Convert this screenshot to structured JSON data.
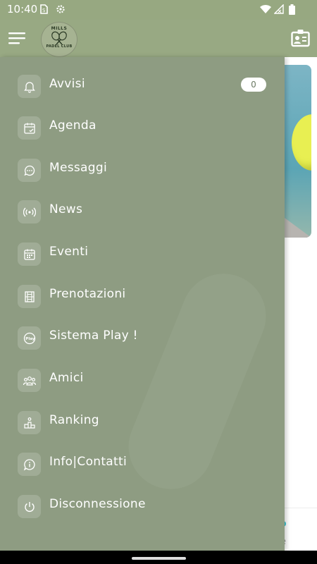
{
  "status_bar": {
    "time": "10:40"
  },
  "app_bar": {
    "logo_line1": "MILLS",
    "logo_line2": "PADEL CLUB"
  },
  "menu": {
    "items": [
      {
        "label": "Avvisi",
        "icon": "bell-icon",
        "badge": "0"
      },
      {
        "label": "Agenda",
        "icon": "calendar-check-icon"
      },
      {
        "label": "Messaggi",
        "icon": "chat-icon"
      },
      {
        "label": "News",
        "icon": "broadcast-icon"
      },
      {
        "label": "Eventi",
        "icon": "calendar-grid-icon"
      },
      {
        "label": "Prenotazioni",
        "icon": "court-icon"
      },
      {
        "label": "Sistema Play !",
        "icon": "play-icon"
      },
      {
        "label": "Amici",
        "icon": "friends-icon"
      },
      {
        "label": "Ranking",
        "icon": "podium-icon"
      },
      {
        "label": "Info|Contatti",
        "icon": "info-icon"
      },
      {
        "label": "Disconnessione",
        "icon": "power-icon"
      }
    ]
  },
  "background_card": {
    "trailing_text": "e"
  },
  "colors": {
    "appbar": "#98a983",
    "drawer": "#8e9c82",
    "icon_tile": "#a0ac96"
  }
}
